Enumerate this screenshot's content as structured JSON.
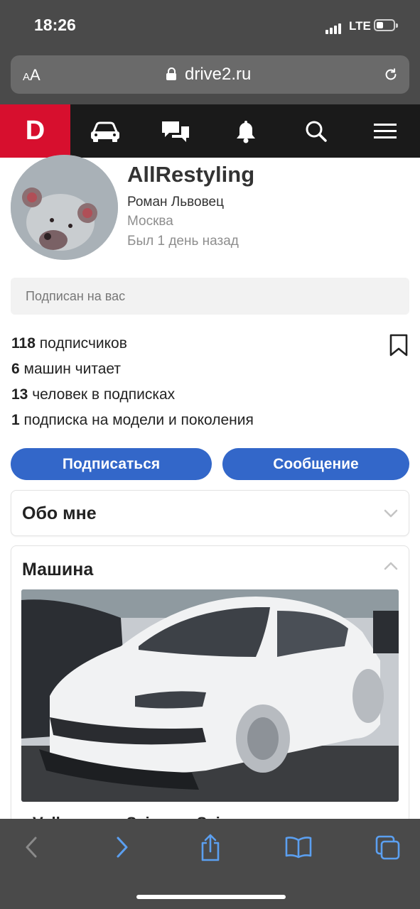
{
  "status": {
    "time": "18:26",
    "network": "LTE"
  },
  "browser": {
    "text_size_label": "AA",
    "domain": "drive2.ru"
  },
  "nav": {
    "logo": "D",
    "icons": [
      "car-icon",
      "chat-icon",
      "bell-icon",
      "search-icon",
      "menu-icon"
    ]
  },
  "profile": {
    "nickname": "AllRestyling",
    "real_name": "Роман Львовец",
    "city": "Москва",
    "last_seen": "Был 1 день назад",
    "subscribed_note": "Подписан на вас"
  },
  "stats": [
    {
      "count": "118",
      "label": "подписчиков"
    },
    {
      "count": "6",
      "label": "машин читает"
    },
    {
      "count": "13",
      "label": "человек в подписках"
    },
    {
      "count": "1",
      "label": "подписка на модели и поколения"
    }
  ],
  "actions": {
    "subscribe": "Подписаться",
    "message": "Сообщение"
  },
  "sections": {
    "about": {
      "title": "Обо мне",
      "expanded": false
    },
    "car": {
      "title": "Машина",
      "expanded": true,
      "caption": "Volkswagen Scirocco Scirocco"
    }
  },
  "colors": {
    "brand": "#d70f2e",
    "button": "#3367c9",
    "nav_bg": "#1a1a1a",
    "browser_chrome": "#4a4a4a"
  }
}
